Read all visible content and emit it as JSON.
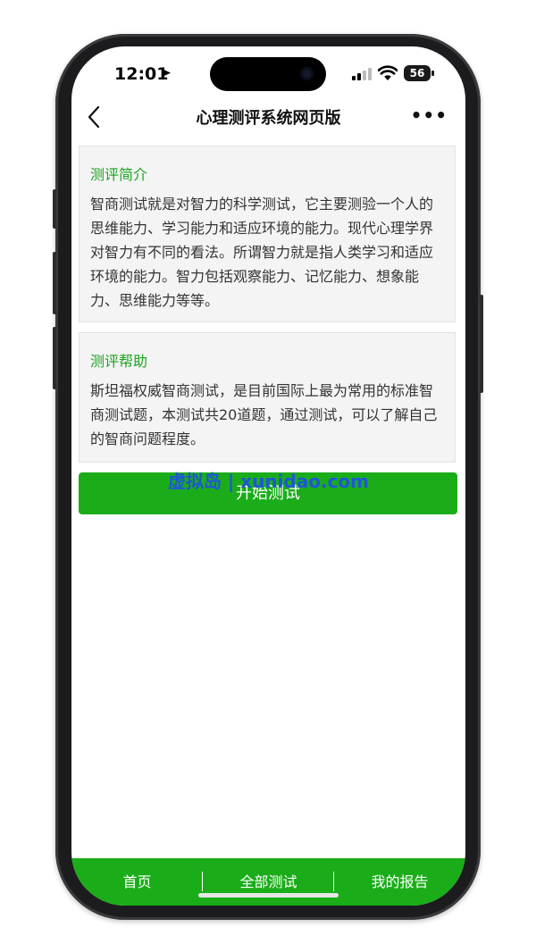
{
  "status_bar": {
    "time": "12:01",
    "battery": "56"
  },
  "nav": {
    "title": "心理测评系统网页版",
    "more": "•••"
  },
  "sections": [
    {
      "title": "测评简介",
      "body": "智商测试就是对智力的科学测试，它主要测验一个人的思维能力、学习能力和适应环境的能力。现代心理学界对智力有不同的看法。所谓智力就是指人类学习和适应环境的能力。智力包括观察能力、记忆能力、想象能力、思维能力等等。"
    },
    {
      "title": "测评帮助",
      "body": "斯坦福权威智商测试，是目前国际上最为常用的标准智商测试题，本测试共20道题，通过测试，可以了解自己的智商问题程度。"
    }
  ],
  "start_button": "开始测试",
  "watermark": "虚拟岛 | xunidao.com",
  "tabs": [
    "首页",
    "全部测试",
    "我的报告"
  ],
  "colors": {
    "accent": "#1aad19",
    "section_title": "#19a31d",
    "watermark": "#1f56d8"
  }
}
